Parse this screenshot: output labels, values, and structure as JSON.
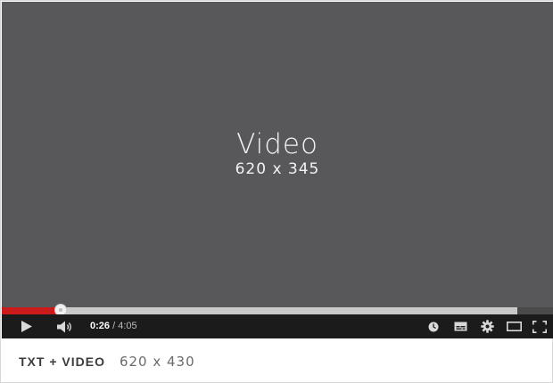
{
  "video": {
    "title": "Video",
    "size_label": "620 x 345",
    "background": "#58585a"
  },
  "player": {
    "progress_fraction": 0.106,
    "buffered_fraction": 0.935,
    "played_color": "#cc1b1b",
    "current_time": "0:26",
    "separator": " / ",
    "duration": "4:05",
    "icons": {
      "play": "play-icon",
      "volume": "volume-icon",
      "watch_later": "clock-icon",
      "captions": "captions-icon",
      "settings": "gear-icon",
      "theater": "theater-mode-icon",
      "fullscreen": "fullscreen-icon"
    }
  },
  "footer": {
    "title": "TXT + VIDEO",
    "size_label": "620 x 430"
  }
}
